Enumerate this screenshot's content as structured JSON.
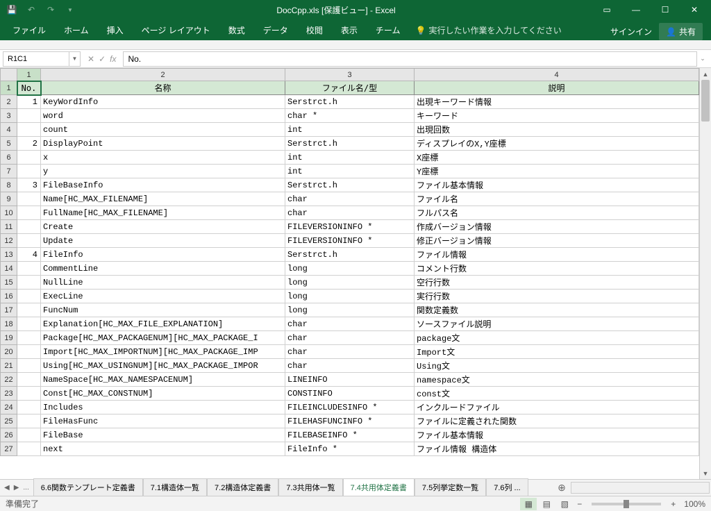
{
  "titlebar": {
    "title": "DocCpp.xls [保護ビュー] - Excel"
  },
  "ribbon": {
    "tabs": [
      "ファイル",
      "ホーム",
      "挿入",
      "ページ レイアウト",
      "数式",
      "データ",
      "校閲",
      "表示",
      "チーム"
    ],
    "tell_me": "実行したい作業を入力してください",
    "sign_in": "サインイン",
    "share": "共有"
  },
  "formula_bar": {
    "name_box": "R1C1",
    "value": "No."
  },
  "columns": [
    "1",
    "2",
    "3",
    "4"
  ],
  "header_row": {
    "no": "No.",
    "name": "名称",
    "file": "ファイル名/型",
    "desc": "説明"
  },
  "rows": [
    {
      "n": "1",
      "c1": "1",
      "c2": "KeyWordInfo",
      "c3": "Serstrct.h",
      "c4": "出現キーワード情報"
    },
    {
      "n": "2",
      "c1": "",
      "c2": "word",
      "c3": "char *",
      "c4": "キーワード"
    },
    {
      "n": "3",
      "c1": "",
      "c2": "count",
      "c3": "int",
      "c4": "出現回数"
    },
    {
      "n": "4",
      "c1": "2",
      "c2": "DisplayPoint",
      "c3": "Serstrct.h",
      "c4": "ディスプレイのX,Y座標"
    },
    {
      "n": "5",
      "c1": "",
      "c2": "x",
      "c3": "int",
      "c4": "X座標"
    },
    {
      "n": "6",
      "c1": "",
      "c2": "y",
      "c3": "int",
      "c4": "Y座標"
    },
    {
      "n": "7",
      "c1": "3",
      "c2": "FileBaseInfo",
      "c3": "Serstrct.h",
      "c4": "ファイル基本情報"
    },
    {
      "n": "8",
      "c1": "",
      "c2": "Name[HC_MAX_FILENAME]",
      "c3": "char",
      "c4": "ファイル名"
    },
    {
      "n": "9",
      "c1": "",
      "c2": "FullName[HC_MAX_FILENAME]",
      "c3": "char",
      "c4": "フルパス名"
    },
    {
      "n": "10",
      "c1": "",
      "c2": "Create",
      "c3": "FILEVERSIONINFO *",
      "c4": "作成バージョン情報"
    },
    {
      "n": "11",
      "c1": "",
      "c2": "Update",
      "c3": "FILEVERSIONINFO *",
      "c4": "修正バージョン情報"
    },
    {
      "n": "12",
      "c1": "4",
      "c2": "FileInfo",
      "c3": "Serstrct.h",
      "c4": "ファイル情報"
    },
    {
      "n": "13",
      "c1": "",
      "c2": "CommentLine",
      "c3": "long",
      "c4": "コメント行数"
    },
    {
      "n": "14",
      "c1": "",
      "c2": "NullLine",
      "c3": "long",
      "c4": "空行行数"
    },
    {
      "n": "15",
      "c1": "",
      "c2": "ExecLine",
      "c3": "long",
      "c4": "実行行数"
    },
    {
      "n": "16",
      "c1": "",
      "c2": "FuncNum",
      "c3": "long",
      "c4": "関数定義数"
    },
    {
      "n": "17",
      "c1": "",
      "c2": "Explanation[HC_MAX_FILE_EXPLANATION]",
      "c3": "char",
      "c4": "ソースファイル説明"
    },
    {
      "n": "18",
      "c1": "",
      "c2": "Package[HC_MAX_PACKAGENUM][HC_MAX_PACKAGE_I",
      "c3": "char",
      "c4": "package文"
    },
    {
      "n": "19",
      "c1": "",
      "c2": "Import[HC_MAX_IMPORTNUM][HC_MAX_PACKAGE_IMP",
      "c3": "char",
      "c4": "Import文"
    },
    {
      "n": "20",
      "c1": "",
      "c2": "Using[HC_MAX_USINGNUM][HC_MAX_PACKAGE_IMPOR",
      "c3": "char",
      "c4": "Using文"
    },
    {
      "n": "21",
      "c1": "",
      "c2": "NameSpace[HC_MAX_NAMESPACENUM]",
      "c3": "LINEINFO",
      "c4": "namespace文"
    },
    {
      "n": "22",
      "c1": "",
      "c2": "Const[HC_MAX_CONSTNUM]",
      "c3": "CONSTINFO",
      "c4": "const文"
    },
    {
      "n": "23",
      "c1": "",
      "c2": "Includes",
      "c3": "FILEINCLUDESINFO *",
      "c4": "インクルードファイル"
    },
    {
      "n": "24",
      "c1": "",
      "c2": "FileHasFunc",
      "c3": "FILEHASFUNCINFO *",
      "c4": "ファイルに定義された関数"
    },
    {
      "n": "25",
      "c1": "",
      "c2": "FileBase",
      "c3": "FILEBASEINFO *",
      "c4": "ファイル基本情報"
    },
    {
      "n": "26",
      "c1": "",
      "c2": "next",
      "c3": "FileInfo *",
      "c4": "ファイル情報 構造体"
    }
  ],
  "sheet_tabs": {
    "ellipsis": "...",
    "tabs": [
      "6.6関数テンプレート定義書",
      "7.1構造体一覧",
      "7.2構造体定義書",
      "7.3共用体一覧",
      "7.4共用体定義書",
      "7.5列挙定数一覧",
      "7.6列 ..."
    ],
    "active_index": 4
  },
  "status": {
    "ready": "準備完了",
    "zoom": "100%"
  }
}
